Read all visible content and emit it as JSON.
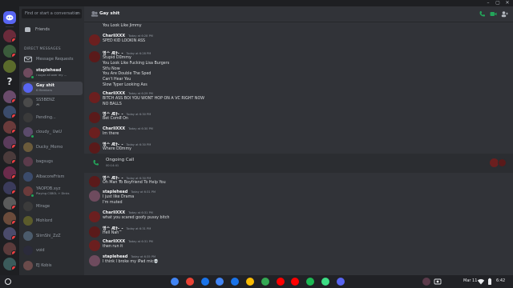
{
  "window": {
    "minimize_glyph": "–",
    "restore_glyph": "▢",
    "close_glyph": "✕"
  },
  "dm_sidebar": {
    "search_placeholder": "Find or start a conversation",
    "friends_label": "Friends",
    "section_header": "DIRECT MESSAGES",
    "message_requests_label": "Message Requests",
    "items": [
      {
        "name": "staplehead",
        "sub": "i sugar all over my ...",
        "avatar_color": "#6e4b5e"
      },
      {
        "name": "Gay shit",
        "sub": "6 Members",
        "avatar_color": "#5865f2"
      },
      {
        "name": "SS5BENZ",
        "sub": "🎮",
        "avatar_color": "#4a4a4a"
      },
      {
        "name": "Pending...",
        "sub": "",
        "avatar_color": "#3a3a3a"
      },
      {
        "name": "cloudy_ UwU",
        "sub": "",
        "avatar_color": "#5b4b6b"
      },
      {
        "name": "Ducky_Momo",
        "sub": "",
        "avatar_color": "#6b5b3b"
      },
      {
        "name": "bagsugs",
        "sub": "",
        "avatar_color": "#5b3b4b"
      },
      {
        "name": "AlbacoreFrism",
        "sub": "",
        "avatar_color": "#3b4b6b"
      },
      {
        "name": "YAOPDB.xyz",
        "sub": "Playing CSBOL + Dinks",
        "avatar_color": "#6b3b3b"
      },
      {
        "name": "Mirage",
        "sub": "",
        "avatar_color": "#3b3b3b"
      },
      {
        "name": "Mohlord",
        "sub": "",
        "avatar_color": "#5b5b2b"
      },
      {
        "name": "SlimShi_ZzZ",
        "sub": "",
        "avatar_color": "#4b5b6b"
      },
      {
        "name": "void",
        "sub": "",
        "avatar_color": "#2b2b3b"
      },
      {
        "name": "EJ Kobis",
        "sub": "",
        "avatar_color": "#6b4b4b"
      },
      {
        "name": "teenagers",
        "sub": "",
        "avatar_color": "#4b6b4b"
      },
      {
        "name": "dir-Fast-Mr-off",
        "sub": "",
        "avatar_color": "#5b4b4b"
      }
    ]
  },
  "chat": {
    "title": "Gay shit",
    "messages": [
      {
        "author": "",
        "time": "",
        "lines": [
          "You Look Like Jimmy"
        ],
        "continuation": true,
        "avatar_color": "#6e2222"
      },
      {
        "author": "CharliXXX",
        "time": "Today at 6:28 PM",
        "lines": [
          "SPED KID LOOKIN ASS"
        ],
        "avatar_color": "#6b1f1f"
      },
      {
        "author": "명ᄉ Æ†-_-",
        "time": "Today at 6:28 PM",
        "lines": [
          "Stupid Dummy",
          "You Look Like Fucking Lisa Burgers",
          "Stfu Now",
          "You Are Double The Sped",
          "Can't Hear You",
          "Slow Typer Looking Ass"
        ],
        "avatar_color": "#5a1a1a"
      },
      {
        "author": "CharliXXX",
        "time": "Today at 6:29 PM",
        "lines": [
          "BITCH ASS BOI YOU WONT HOP ON A VC RIGHT NOW",
          "NO BALLS"
        ],
        "avatar_color": "#6b1f1f"
      },
      {
        "author": "명ᄉ Æ†-_-",
        "time": "Today at 6:30 PM",
        "lines": [
          "Bet Come On"
        ],
        "avatar_color": "#5a1a1a"
      },
      {
        "author": "CharliXXX",
        "time": "Today at 6:30 PM",
        "lines": [
          "Im there"
        ],
        "avatar_color": "#6b1f1f"
      },
      {
        "author": "명ᄉ Æ†-_-",
        "time": "Today at 6:30 PM",
        "lines": [
          "Where Dummy"
        ],
        "avatar_color": "#5a1a1a"
      },
      {
        "author": "명ᄉ Æ†-_-",
        "time": "Today at 6:30 PM",
        "lines": [
          "Oh Man Yo Boyfriend To Help You"
        ],
        "avatar_color": "#5a1a1a"
      },
      {
        "author": "staplehead",
        "time": "Today at 6:31 PM",
        "lines": [
          "I just like Drama",
          "I'm muted"
        ],
        "avatar_color": "#6e4b5e"
      },
      {
        "author": "CharliXXX",
        "time": "Today at 6:31 PM",
        "lines": [
          "what you scared goofy pussy bitch"
        ],
        "avatar_color": "#6b1f1f"
      },
      {
        "author": "명ᄉ Æ†-_-",
        "time": "Today at 6:31 PM",
        "lines": [
          "Hell Nah"
        ],
        "avatar_color": "#5a1a1a"
      },
      {
        "author": "CharliXXX",
        "time": "Today at 6:31 PM",
        "lines": [
          "then run it"
        ],
        "avatar_color": "#6b1f1f"
      },
      {
        "author": "staplehead",
        "time": "Today at 6:35 PM",
        "lines": [
          "I think I broke my iPad mic💀"
        ],
        "avatar_color": "#6e4b5e"
      }
    ],
    "call": {
      "title": "Ongoing Call",
      "duration": "00:14:41"
    }
  },
  "shelf": {
    "date": "Mar 11",
    "time": "6:42",
    "apps": [
      {
        "name": "chrome-icon",
        "color": "#4285f4"
      },
      {
        "name": "gmail-icon",
        "color": "#ea4335"
      },
      {
        "name": "files-icon",
        "color": "#1a73e8"
      },
      {
        "name": "docs-icon",
        "color": "#4285f4"
      },
      {
        "name": "messages-icon",
        "color": "#1a73e8"
      },
      {
        "name": "photos-icon",
        "color": "#fbbc04"
      },
      {
        "name": "play-store-icon",
        "color": "#34a853"
      },
      {
        "name": "youtube-icon",
        "color": "#ff0000"
      },
      {
        "name": "youtube-music-icon",
        "color": "#ff0000"
      },
      {
        "name": "spotify-icon",
        "color": "#1db954"
      },
      {
        "name": "android-icon",
        "color": "#3ddc84"
      },
      {
        "name": "discord-icon",
        "color": "#5865f2"
      }
    ]
  },
  "colors": {
    "blurple": "#5865f2",
    "green": "#23a55a",
    "red": "#f23f43"
  }
}
